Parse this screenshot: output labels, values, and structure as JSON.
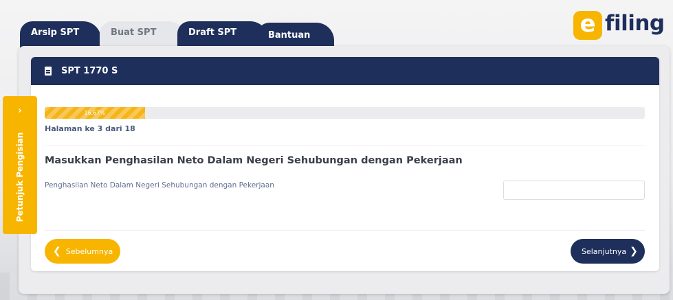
{
  "tabs": [
    {
      "label": "Arsip SPT",
      "active": true
    },
    {
      "label": "Buat SPT",
      "active": false
    },
    {
      "label": "Draft SPT",
      "active": true
    },
    {
      "label": "Bantuan",
      "active": true
    }
  ],
  "logo": {
    "mark": "e",
    "text": "filing"
  },
  "card": {
    "title": "SPT 1770 S",
    "icon": "document-icon"
  },
  "progress": {
    "value": 0.1667,
    "label": "16.67%"
  },
  "page_indicator": "Halaman ke 3 dari 18",
  "section_title": "Masukkan Penghasilan Neto Dalam Negeri Sehubungan dengan Pekerjaan",
  "field": {
    "label": "Penghasilan Neto Dalam Negeri Sehubungan dengan Pekerjaan",
    "value": "",
    "placeholder": ""
  },
  "buttons": {
    "prev": "Sebelumnya",
    "next": "Selanjutnya"
  },
  "side_tab": {
    "label": "Petunjuk Pengisian",
    "icon": "chevron-right-icon"
  },
  "colors": {
    "navy": "#1f2f5c",
    "accent": "#f7b500",
    "muted": "#ececee"
  }
}
